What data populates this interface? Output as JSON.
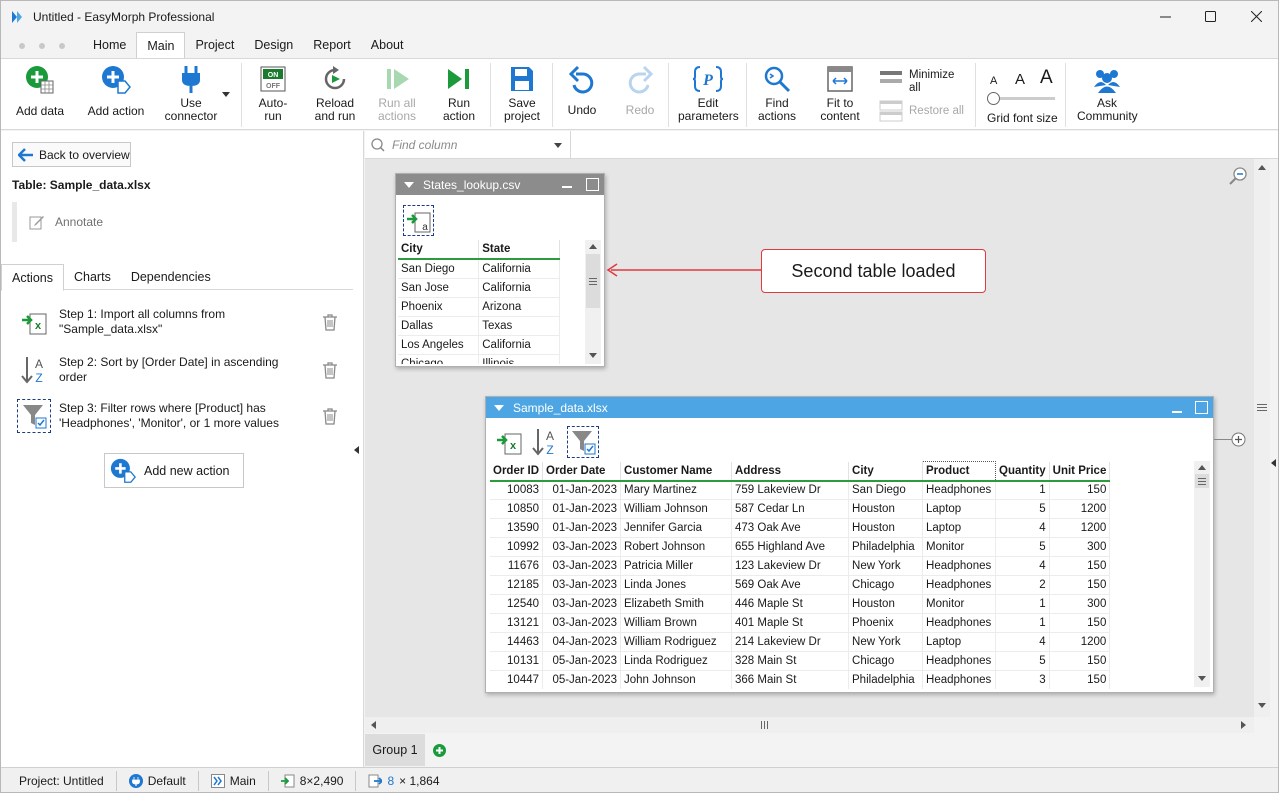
{
  "window": {
    "title": "Untitled - EasyMorph Professional"
  },
  "menu": {
    "tabs": [
      "Home",
      "Main",
      "Project",
      "Design",
      "Report",
      "About"
    ],
    "active": "Main"
  },
  "ribbon": {
    "add_data": "Add data",
    "add_action": "Add action",
    "use_connector": "Use connector",
    "auto_run": "Auto-run",
    "reload_and_run": "Reload and run",
    "run_all_actions": "Run all actions",
    "run_action": "Run action",
    "save_project": "Save project",
    "undo": "Undo",
    "redo": "Redo",
    "edit_parameters": "Edit parameters",
    "find_actions": "Find actions",
    "fit_to_content": "Fit to content",
    "minimize_all": "Minimize all",
    "restore_all": "Restore all",
    "grid_font_size": "Grid font size",
    "ask_community": "Ask Community",
    "auto_run_on": "ON",
    "auto_run_off": "OFF",
    "font_sizes": [
      "A",
      "A",
      "A"
    ]
  },
  "left": {
    "back_label": "Back to overview",
    "table_title": "Table: Sample_data.xlsx",
    "annotate": "Annotate",
    "tabs": [
      "Actions",
      "Charts",
      "Dependencies"
    ],
    "steps": [
      "Step 1: Import all columns from \"Sample_data.xlsx\"",
      "Step 2: Sort by [Order Date] in ascending order",
      "Step 3: Filter rows where [Product] has 'Headphones', 'Monitor', or 1 more values"
    ],
    "add_new_action": "Add new action"
  },
  "canvas": {
    "find_column_placeholder": "Find column",
    "callout": "Second table loaded"
  },
  "states_table": {
    "title": "States_lookup.csv",
    "columns": [
      "City",
      "State"
    ],
    "rows": [
      [
        "San Diego",
        "California"
      ],
      [
        "San Jose",
        "California"
      ],
      [
        "Phoenix",
        "Arizona"
      ],
      [
        "Dallas",
        "Texas"
      ],
      [
        "Los Angeles",
        "California"
      ],
      [
        "Chicago",
        "Illinois"
      ]
    ]
  },
  "sample_table": {
    "title": "Sample_data.xlsx",
    "columns": [
      "Order ID",
      "Order Date",
      "Customer Name",
      "Address",
      "City",
      "Product",
      "Quantity",
      "Unit Price"
    ],
    "rows": [
      [
        "10083",
        "01-Jan-2023",
        "Mary Martinez",
        "759 Lakeview Dr",
        "San Diego",
        "Headphones",
        "1",
        "150"
      ],
      [
        "10850",
        "01-Jan-2023",
        "William Johnson",
        "587 Cedar Ln",
        "Houston",
        "Laptop",
        "5",
        "1200"
      ],
      [
        "13590",
        "01-Jan-2023",
        "Jennifer Garcia",
        "473 Oak Ave",
        "Houston",
        "Laptop",
        "4",
        "1200"
      ],
      [
        "10992",
        "03-Jan-2023",
        "Robert Johnson",
        "655 Highland Ave",
        "Philadelphia",
        "Monitor",
        "5",
        "300"
      ],
      [
        "11676",
        "03-Jan-2023",
        "Patricia Miller",
        "123 Lakeview Dr",
        "New York",
        "Headphones",
        "4",
        "150"
      ],
      [
        "12185",
        "03-Jan-2023",
        "Linda Jones",
        "569 Oak Ave",
        "Chicago",
        "Headphones",
        "2",
        "150"
      ],
      [
        "12540",
        "03-Jan-2023",
        "Elizabeth Smith",
        "446 Maple St",
        "Houston",
        "Monitor",
        "1",
        "300"
      ],
      [
        "13121",
        "03-Jan-2023",
        "William Brown",
        "401 Maple St",
        "Phoenix",
        "Headphones",
        "1",
        "150"
      ],
      [
        "14463",
        "04-Jan-2023",
        "William Rodriguez",
        "214 Lakeview Dr",
        "New York",
        "Laptop",
        "4",
        "1200"
      ],
      [
        "10131",
        "05-Jan-2023",
        "Linda Rodriguez",
        "328 Main St",
        "Chicago",
        "Headphones",
        "5",
        "150"
      ],
      [
        "10447",
        "05-Jan-2023",
        "John Johnson",
        "366 Main St",
        "Philadelphia",
        "Headphones",
        "3",
        "150"
      ]
    ]
  },
  "group_tab": "Group 1",
  "status": {
    "project": "Project:  Untitled",
    "connector": "Default",
    "module": "Main",
    "source_size": "8×2,490",
    "result_cols": "8",
    "result_rows": "× 1,864"
  },
  "colors": {
    "active_table_header": "#4da6e3",
    "inactive_table_header": "#8c8c8c",
    "accent_green": "#1a9a3a",
    "accent_blue": "#1e78d2",
    "callout_border": "#e0393e"
  }
}
